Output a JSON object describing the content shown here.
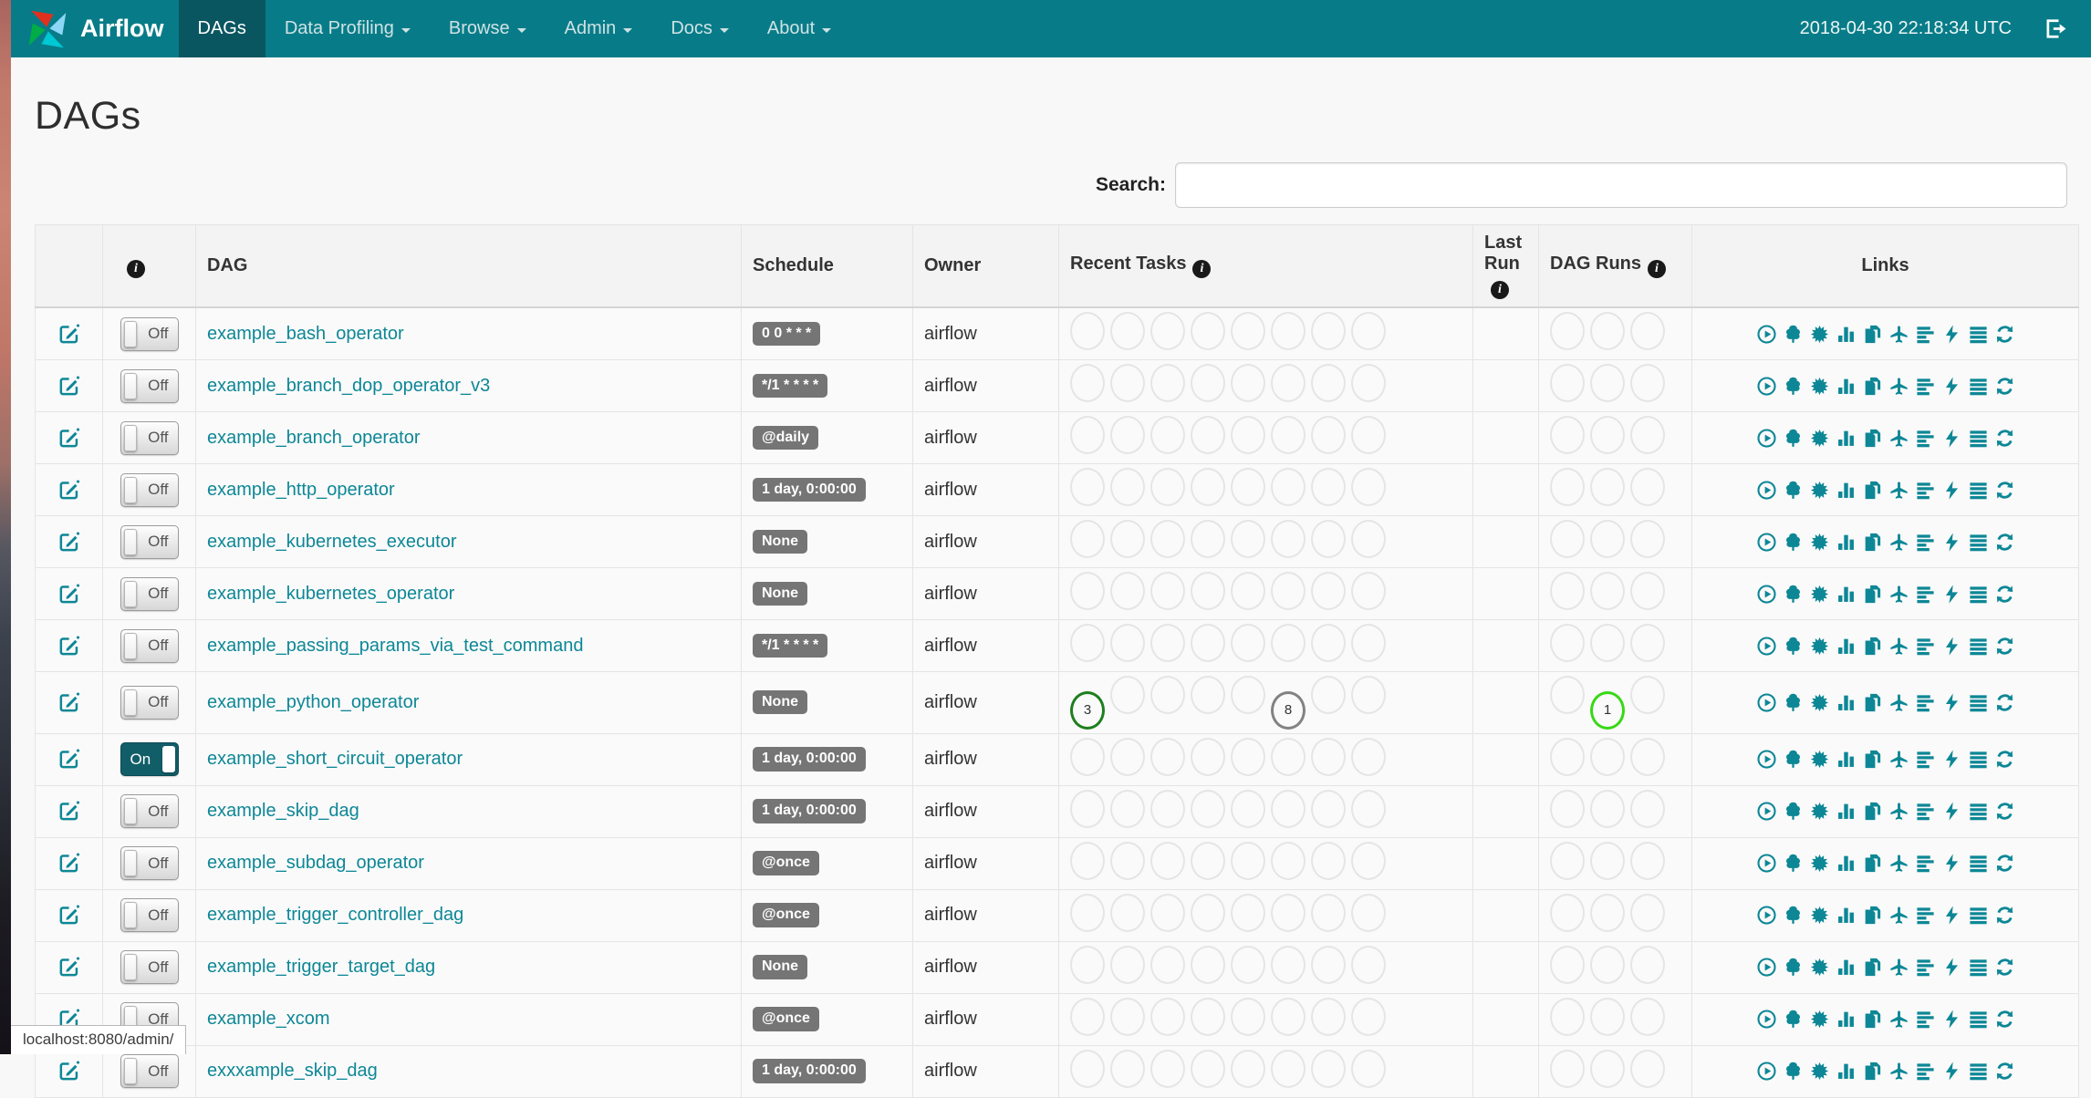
{
  "navbar": {
    "brand": "Airflow",
    "items": [
      {
        "label": "DAGs",
        "active": true,
        "dropdown": false
      },
      {
        "label": "Data Profiling",
        "active": false,
        "dropdown": true
      },
      {
        "label": "Browse",
        "active": false,
        "dropdown": true
      },
      {
        "label": "Admin",
        "active": false,
        "dropdown": true
      },
      {
        "label": "Docs",
        "active": false,
        "dropdown": true
      },
      {
        "label": "About",
        "active": false,
        "dropdown": true
      }
    ],
    "clock": "2018-04-30 22:18:34 UTC"
  },
  "page": {
    "title": "DAGs",
    "search_label": "Search:",
    "search_value": "",
    "statusbar_text": "localhost:8080/admin/"
  },
  "icons": {
    "brand": "airflow-pinwheel",
    "logout": "sign-out",
    "edit": "pencil-square",
    "info": "info-circle",
    "dropdown": "caret-down"
  },
  "table": {
    "headers": {
      "dag": "DAG",
      "schedule": "Schedule",
      "owner": "Owner",
      "recent_tasks": "Recent Tasks",
      "last_run": "Last Run",
      "dag_runs": "DAG Runs",
      "links": "Links"
    },
    "recent_task_slots": 8,
    "dag_run_slots": 3,
    "link_icons": [
      "trigger-dag",
      "tree-view",
      "graph-view",
      "task-duration",
      "task-tries",
      "landing-times",
      "gantt-view",
      "code-view",
      "task-instances",
      "refresh"
    ],
    "rows": [
      {
        "toggle": "Off",
        "dag_id": "example_bash_operator",
        "schedule": "0 0 * * *",
        "owner": "airflow",
        "recent_tasks": [],
        "dag_runs": []
      },
      {
        "toggle": "Off",
        "dag_id": "example_branch_dop_operator_v3",
        "schedule": "*/1 * * * *",
        "owner": "airflow",
        "recent_tasks": [],
        "dag_runs": []
      },
      {
        "toggle": "Off",
        "dag_id": "example_branch_operator",
        "schedule": "@daily",
        "owner": "airflow",
        "recent_tasks": [],
        "dag_runs": []
      },
      {
        "toggle": "Off",
        "dag_id": "example_http_operator",
        "schedule": "1 day, 0:00:00",
        "owner": "airflow",
        "recent_tasks": [],
        "dag_runs": []
      },
      {
        "toggle": "Off",
        "dag_id": "example_kubernetes_executor",
        "schedule": "None",
        "owner": "airflow",
        "recent_tasks": [],
        "dag_runs": []
      },
      {
        "toggle": "Off",
        "dag_id": "example_kubernetes_operator",
        "schedule": "None",
        "owner": "airflow",
        "recent_tasks": [],
        "dag_runs": []
      },
      {
        "toggle": "Off",
        "dag_id": "example_passing_params_via_test_command",
        "schedule": "*/1 * * * *",
        "owner": "airflow",
        "recent_tasks": [],
        "dag_runs": []
      },
      {
        "toggle": "Off",
        "dag_id": "example_python_operator",
        "schedule": "None",
        "owner": "airflow",
        "recent_tasks": [
          {
            "slot": 0,
            "count": 3,
            "state": "success"
          },
          {
            "slot": 5,
            "count": 8,
            "state": "queued"
          }
        ],
        "dag_runs": [
          {
            "slot": 1,
            "count": 1,
            "state": "running"
          }
        ]
      },
      {
        "toggle": "On",
        "dag_id": "example_short_circuit_operator",
        "schedule": "1 day, 0:00:00",
        "owner": "airflow",
        "recent_tasks": [],
        "dag_runs": []
      },
      {
        "toggle": "Off",
        "dag_id": "example_skip_dag",
        "schedule": "1 day, 0:00:00",
        "owner": "airflow",
        "recent_tasks": [],
        "dag_runs": []
      },
      {
        "toggle": "Off",
        "dag_id": "example_subdag_operator",
        "schedule": "@once",
        "owner": "airflow",
        "recent_tasks": [],
        "dag_runs": []
      },
      {
        "toggle": "Off",
        "dag_id": "example_trigger_controller_dag",
        "schedule": "@once",
        "owner": "airflow",
        "recent_tasks": [],
        "dag_runs": []
      },
      {
        "toggle": "Off",
        "dag_id": "example_trigger_target_dag",
        "schedule": "None",
        "owner": "airflow",
        "recent_tasks": [],
        "dag_runs": []
      },
      {
        "toggle": "Off",
        "dag_id": "example_xcom",
        "schedule": "@once",
        "owner": "airflow",
        "recent_tasks": [],
        "dag_runs": []
      },
      {
        "toggle": "Off",
        "dag_id": "exxxample_skip_dag",
        "schedule": "1 day, 0:00:00",
        "owner": "airflow",
        "recent_tasks": [],
        "dag_runs": []
      }
    ]
  },
  "colors": {
    "navbar": "#077c88",
    "navbar_active": "#0a5660",
    "link_teal": "#0d8796",
    "badge_bg": "#757575",
    "state_success": "#1e7e1e",
    "state_queued": "#828282",
    "state_running": "#38d817",
    "circle_empty": "#e5e5e5"
  }
}
